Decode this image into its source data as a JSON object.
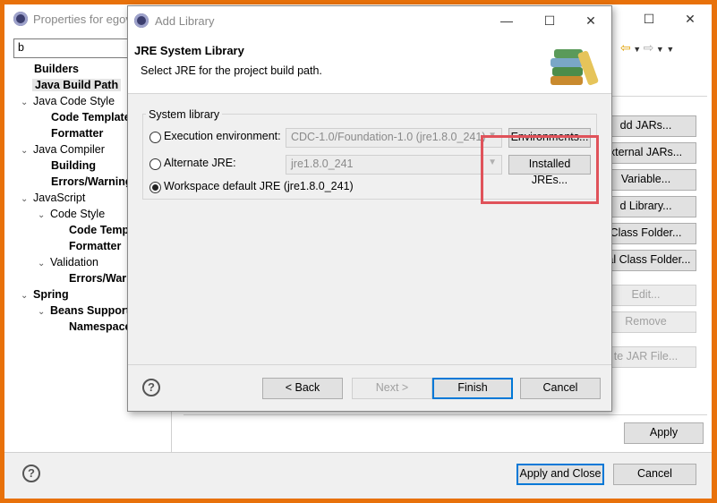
{
  "props_window": {
    "title": "Properties for egov",
    "filter_value": "b",
    "tree": [
      {
        "label": "Builders",
        "bold": true
      },
      {
        "label": "Java Build Path",
        "bold": true,
        "selected": true
      },
      {
        "label": "Java Code Style"
      },
      {
        "label": "Code Template",
        "bold": true
      },
      {
        "label": "Formatter",
        "bold": true
      },
      {
        "label": "Java Compiler"
      },
      {
        "label": "Building",
        "bold": true
      },
      {
        "label": "Errors/Warning",
        "bold": true
      },
      {
        "label": "JavaScript"
      },
      {
        "label": "Code Style"
      },
      {
        "label": "Code Temp",
        "bold": true
      },
      {
        "label": "Formatter",
        "bold": true
      },
      {
        "label": "Validation"
      },
      {
        "label": "Errors/Warn",
        "bold": true
      },
      {
        "label": "Spring",
        "bold": true
      },
      {
        "label": "Beans Support",
        "bold": true
      },
      {
        "label": "Namespace",
        "bold": true
      }
    ],
    "right_buttons": [
      "dd JARs...",
      "xternal JARs...",
      "Variable...",
      "d Library...",
      "Class Folder...",
      "nal Class Folder...",
      "Edit...",
      "Remove",
      "te JAR File..."
    ],
    "apply": "Apply",
    "apply_close": "Apply and Close",
    "cancel": "Cancel"
  },
  "dialog": {
    "title": "Add Library",
    "heading": "JRE System Library",
    "description": "Select JRE for the project build path.",
    "group_label": "System library",
    "options": [
      {
        "label": "Execution environment:",
        "value": "CDC-1.0/Foundation-1.0 (jre1.8.0_241)",
        "button": "Environments...",
        "checked": false
      },
      {
        "label": "Alternate JRE:",
        "value": "jre1.8.0_241",
        "button": "Installed JREs...",
        "checked": false
      },
      {
        "label": "Workspace default JRE (jre1.8.0_241)",
        "checked": true
      }
    ],
    "back": "< Back",
    "next": "Next >",
    "finish": "Finish",
    "cancel": "Cancel"
  },
  "colors": {
    "frame": "#e8710a",
    "highlight": "#e0525a",
    "accent": "#0078d7"
  }
}
